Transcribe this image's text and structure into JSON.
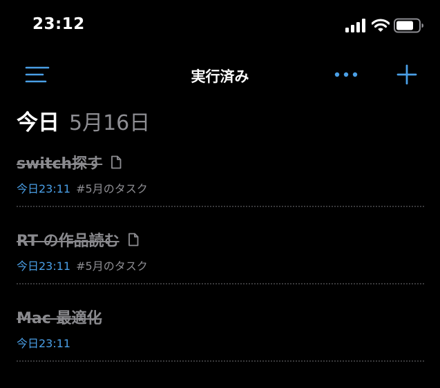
{
  "status_bar": {
    "time": "23:12",
    "icons": [
      "cellular-signal-icon",
      "wifi-icon",
      "battery-icon"
    ]
  },
  "nav": {
    "title": "実行済み",
    "menu_icon": "sidebar-menu-icon",
    "more_icon": "more-icon",
    "add_icon": "add-icon"
  },
  "section": {
    "today_label": "今日",
    "date": "5月16日"
  },
  "tasks": [
    {
      "title": "switch探す",
      "has_note": true,
      "time": "今日23:11",
      "tag": "#5月のタスク"
    },
    {
      "title": "RT の作品読む",
      "has_note": true,
      "time": "今日23:11",
      "tag": "#5月のタスク"
    },
    {
      "title": "Mac 最適化",
      "has_note": false,
      "time": "今日23:11",
      "tag": ""
    }
  ],
  "colors": {
    "background": "#000000",
    "accent": "#4a9fe6",
    "completed_text": "#8a8a8e",
    "secondary_text": "#8e8e93",
    "divider": "#3a3a3c"
  }
}
